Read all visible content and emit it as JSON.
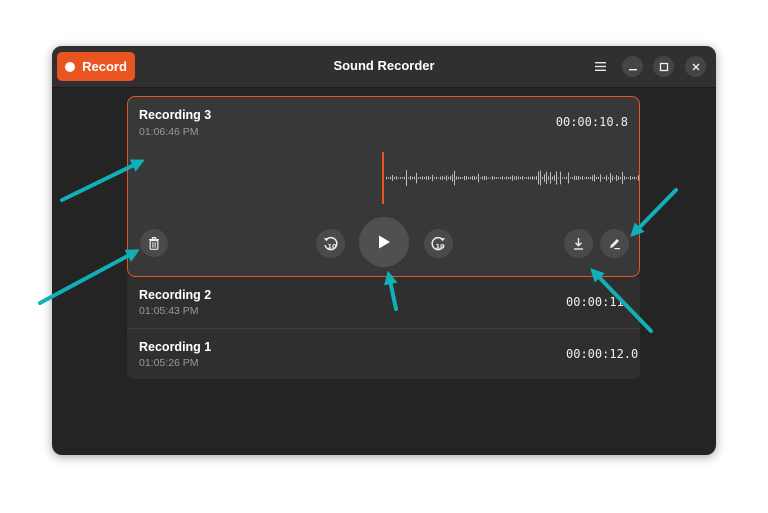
{
  "header": {
    "record_label": "Record",
    "title": "Sound Recorder"
  },
  "recordings": [
    {
      "name": "Recording 3",
      "time": "01:06:46 PM",
      "duration": "00:00:10.8",
      "expanded": true
    },
    {
      "name": "Recording 2",
      "time": "01:05:43 PM",
      "duration": "00:00:11.",
      "expanded": false
    },
    {
      "name": "Recording 1",
      "time": "01:05:26 PM",
      "duration": "00:00:12.0",
      "expanded": false
    }
  ],
  "player": {
    "seek_back_label": "10",
    "seek_forward_label": "10"
  },
  "icons": {
    "menu": "hamburger-menu-icon",
    "minimize": "minimize-icon",
    "maximize": "maximize-icon",
    "close": "close-icon",
    "delete": "trash-icon",
    "play": "play-icon",
    "export": "download-icon",
    "rename": "edit-pen-icon"
  },
  "colors": {
    "accent": "#e95420",
    "annotation_arrow": "#11b0b8",
    "window_bg": "#242424",
    "card_bg": "#383838"
  }
}
